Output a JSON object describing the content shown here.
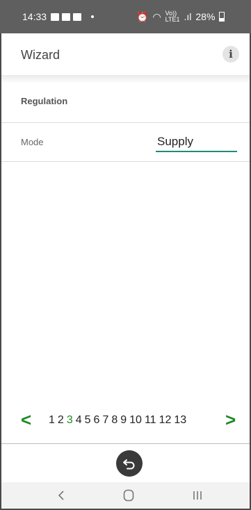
{
  "status_bar": {
    "time": "14:33",
    "network_label": "Vo))\nLTE1",
    "battery": "28%"
  },
  "app_bar": {
    "title": "Wizard",
    "info_symbol": "i"
  },
  "section": {
    "title": "Regulation"
  },
  "mode": {
    "label": "Mode",
    "value": "Supply"
  },
  "pager": {
    "prev": "<",
    "next": ">",
    "pages": [
      "1",
      "2",
      "3",
      "4",
      "5",
      "6",
      "7",
      "8",
      "9",
      "10",
      "11",
      "12",
      "13"
    ],
    "current": "3"
  },
  "colors": {
    "accent_green": "#1f8a24",
    "underline_teal": "#1f8a7a",
    "status_bar": "#5f5f5f"
  },
  "icons": {
    "undo": "undo-icon",
    "info": "info-icon"
  }
}
